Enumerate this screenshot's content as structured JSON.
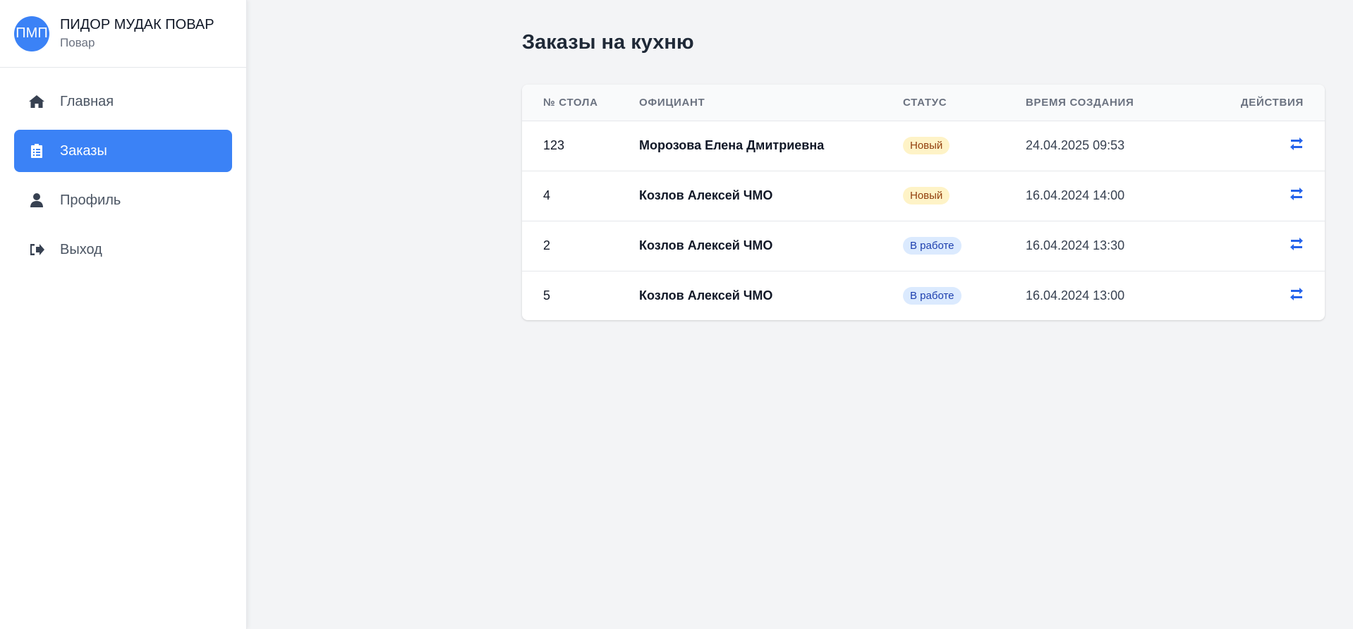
{
  "user": {
    "initials": "ПМП",
    "name": "ПИДОР МУДАК ПОВАР",
    "role": "Повар"
  },
  "nav": {
    "items": [
      {
        "label": "Главная",
        "icon": "home-icon",
        "active": false
      },
      {
        "label": "Заказы",
        "icon": "clipboard-icon",
        "active": true
      },
      {
        "label": "Профиль",
        "icon": "user-icon",
        "active": false
      },
      {
        "label": "Выход",
        "icon": "sign-out-icon",
        "active": false
      }
    ]
  },
  "main": {
    "title": "Заказы на кухню",
    "table": {
      "headers": [
        "№ СТОЛА",
        "ОФИЦИАНТ",
        "СТАТУС",
        "ВРЕМЯ СОЗДАНИЯ",
        "ДЕЙСТВИЯ"
      ],
      "rows": [
        {
          "table_no": "123",
          "waiter": "Морозова Елена Дмитриевна",
          "status": "Новый",
          "status_kind": "new",
          "created": "24.04.2025 09:53",
          "action_icon": "exchange-icon"
        },
        {
          "table_no": "4",
          "waiter": "Козлов Алексей ЧМО",
          "status": "Новый",
          "status_kind": "new",
          "created": "16.04.2024 14:00",
          "action_icon": "exchange-icon"
        },
        {
          "table_no": "2",
          "waiter": "Козлов Алексей ЧМО",
          "status": "В работе",
          "status_kind": "work",
          "created": "16.04.2024 13:30",
          "action_icon": "exchange-icon"
        },
        {
          "table_no": "5",
          "waiter": "Козлов Алексей ЧМО",
          "status": "В работе",
          "status_kind": "work",
          "created": "16.04.2024 13:00",
          "action_icon": "exchange-icon"
        }
      ]
    }
  },
  "colors": {
    "accent": "#3b82f6",
    "status_new_bg": "#fef3c7",
    "status_new_text": "#92400e",
    "status_work_bg": "#dbeafe",
    "status_work_text": "#1e40af",
    "action_icon": "#2563eb"
  }
}
